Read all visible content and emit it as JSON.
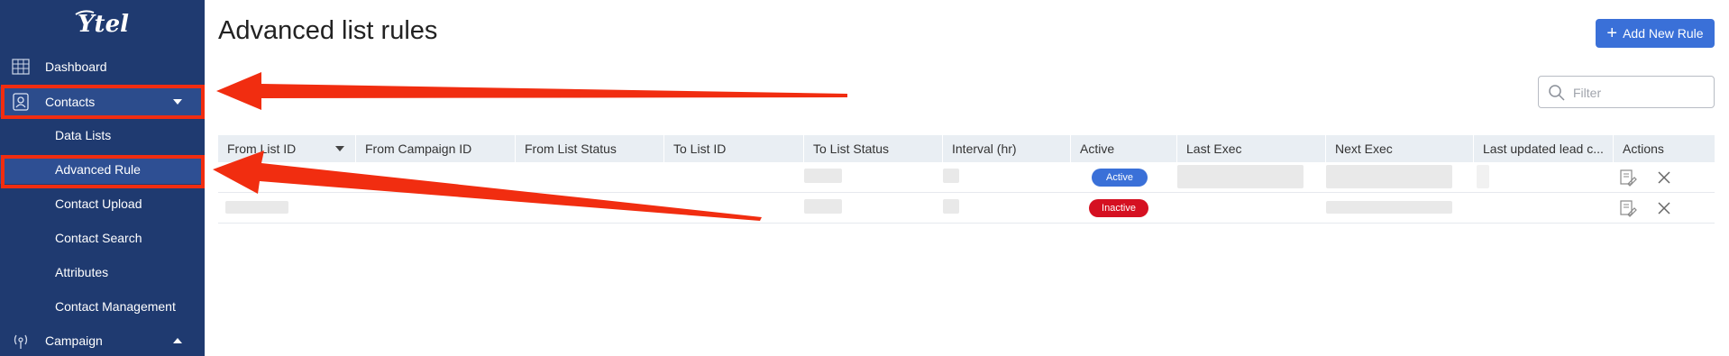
{
  "sidebar": {
    "logo_text": "Ytel",
    "items": [
      {
        "label": "Dashboard",
        "icon": "dashboard-icon"
      },
      {
        "label": "Contacts",
        "icon": "contacts-icon"
      },
      {
        "label": "Campaign",
        "icon": "broadcast-icon"
      }
    ],
    "contacts_sub": [
      {
        "label": "Data Lists"
      },
      {
        "label": "Advanced Rule"
      },
      {
        "label": "Contact Upload"
      },
      {
        "label": "Contact Search"
      },
      {
        "label": "Attributes"
      },
      {
        "label": "Contact Management"
      }
    ]
  },
  "main": {
    "title": "Advanced list rules",
    "add_button_label": "Add New Rule",
    "filter_placeholder": "Filter"
  },
  "table": {
    "columns": [
      "From List ID",
      "From Campaign ID",
      "From List Status",
      "To List ID",
      "To List Status",
      "Interval (hr)",
      "Active",
      "Last Exec",
      "Next Exec",
      "Last updated lead c...",
      "Actions"
    ],
    "rows": [
      {
        "active": "Active"
      },
      {
        "active": "Inactive"
      }
    ]
  },
  "colors": {
    "sidebar_bg": "#1f3a70",
    "accent": "#3a70d8",
    "inactive": "#d51021",
    "annotation": "#f12d10"
  }
}
